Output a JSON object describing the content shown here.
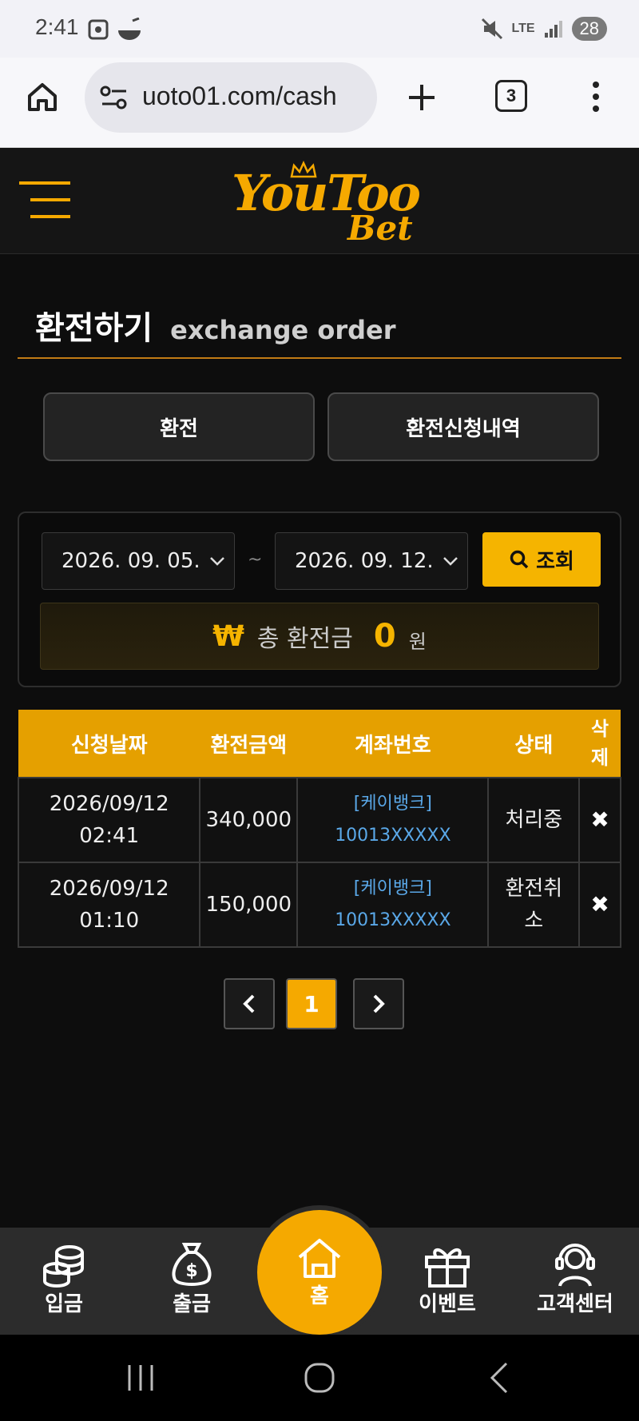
{
  "status_bar": {
    "time": "2:41",
    "network": "LTE",
    "battery": "28"
  },
  "browser": {
    "url": "uoto01.com/cash",
    "tab_count": "3"
  },
  "header": {
    "logo_line1": "YouToo",
    "logo_line2": "Bet"
  },
  "page": {
    "title": "환전하기",
    "subtitle": "exchange order"
  },
  "tabs": [
    {
      "label": "환전"
    },
    {
      "label": "환전신청내역"
    }
  ],
  "filter": {
    "start_date": "2026. 09. 05.",
    "end_date": "2026. 09. 12.",
    "separator": "~",
    "search_label": "조회"
  },
  "total": {
    "currency_symbol": "₩",
    "label": "총 환전금",
    "amount": "0",
    "unit": "원"
  },
  "table": {
    "headers": [
      "신청날짜",
      "환전금액",
      "계좌번호",
      "상태",
      "삭제"
    ],
    "rows": [
      {
        "date": "2026/09/12",
        "time": "02:41",
        "amount": "340,000",
        "bank": "[케이뱅크]",
        "account": "10013XXXXX",
        "status": "처리중",
        "delete": "✖"
      },
      {
        "date": "2026/09/12",
        "time": "01:10",
        "amount": "150,000",
        "bank": "[케이뱅크]",
        "account": "10013XXXXX",
        "status": "환전취소",
        "delete": "✖"
      }
    ]
  },
  "pagination": {
    "current": "1"
  },
  "bottom_nav": {
    "deposit": "입금",
    "withdraw": "출금",
    "home": "홈",
    "event": "이벤트",
    "support": "고객센터"
  },
  "colors": {
    "accent": "#f5a900",
    "background": "#0d0d0d",
    "account_link": "#5aa8e8"
  }
}
